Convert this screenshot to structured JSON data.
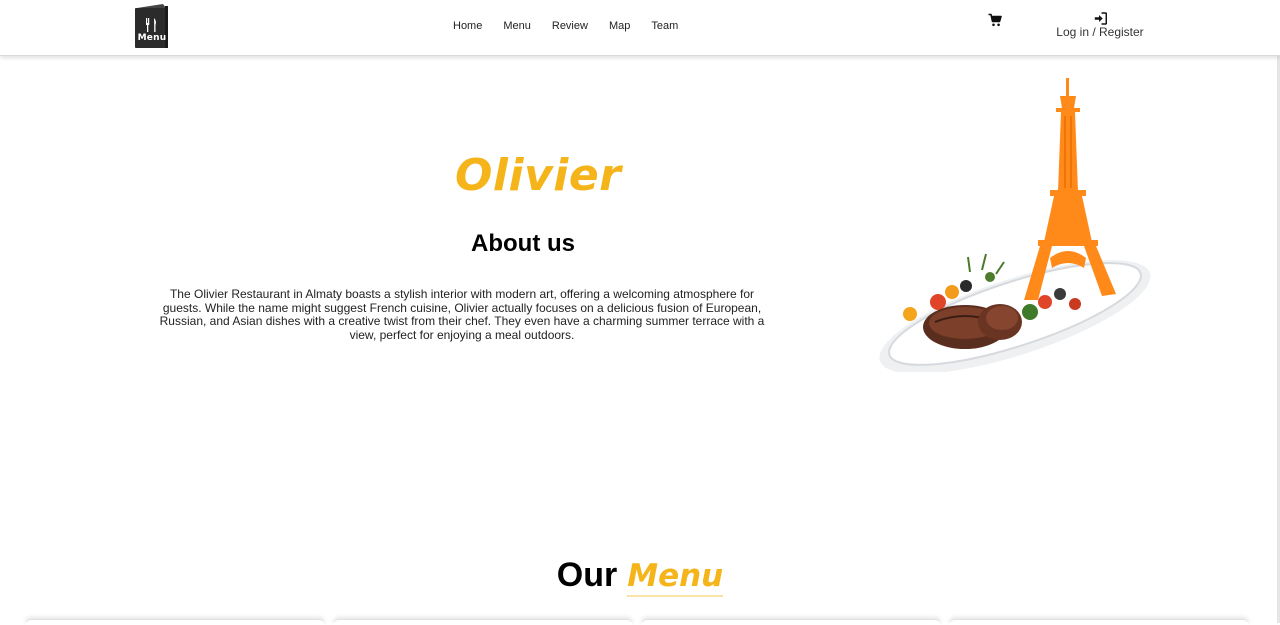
{
  "header": {
    "logo_label": "Menu",
    "nav": [
      {
        "label": "Home"
      },
      {
        "label": "Menu"
      },
      {
        "label": "Review"
      },
      {
        "label": "Map"
      },
      {
        "label": "Team"
      }
    ],
    "cart_icon": "shopping-cart-icon",
    "login_icon": "sign-in-icon",
    "login_label": "Log in / Register"
  },
  "hero": {
    "brand": "Olivier",
    "about_title": "About us",
    "about_text": "The Olivier Restaurant in Almaty boasts a stylish interior with modern art, offering a welcoming atmosphere for guests. While the name might suggest French cuisine, Olivier actually focuses on a delicious fusion of European, Russian, and Asian dishes with a creative twist from their chef. They even have a charming summer terrace with a view, perfect for enjoying a meal outdoors."
  },
  "menu_section": {
    "heading_word1": "Our",
    "heading_word2": "Menu"
  },
  "colors": {
    "accent": "#f4b41a",
    "logo_bg": "#2b2b2b",
    "tower": "#ff8a1a"
  }
}
